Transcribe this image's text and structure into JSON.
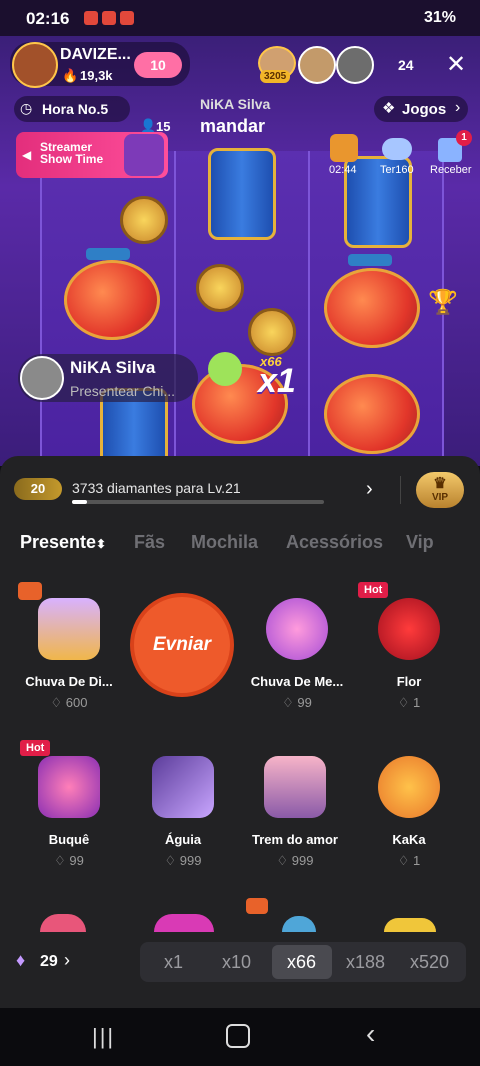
{
  "status_bar": {
    "time": "02:16",
    "battery": "31%"
  },
  "stream": {
    "host_name": "DAVIZE...",
    "host_followers": "19,3k",
    "host_level": "10",
    "top_viewer_count": "3205",
    "viewer_count": "24",
    "hour_label": "Hora No.5",
    "nika_label": "NiKA Silva",
    "mandar_label": "mandar",
    "count_15": "15",
    "jogos_label": "Jogos",
    "banner_title": "Streamer Show Time",
    "timer_text": "02:44",
    "ter_label": "Ter160",
    "receber_label": "Receber",
    "receber_badge": "1",
    "gift_sender_name": "NiKA Silva",
    "gift_sender_action": "Presentear Chi...",
    "multiplier_small": "x66",
    "multiplier_big": "x1"
  },
  "panel": {
    "diamond_level_badge": "20",
    "progress_text": "3733 diamantes para Lv.21",
    "progress_fraction": 0.06,
    "vip_label": "VIP",
    "tabs": [
      "Presente",
      "Fãs",
      "Mochila",
      "Acessórios",
      "Vip"
    ],
    "send_button": "Evniar",
    "gifts_row1": [
      {
        "name": "Chuva De Di...",
        "price": "600",
        "hot": false
      },
      {
        "name": "Chuva De Me...",
        "price": "99",
        "hot": false
      },
      {
        "name": "Flor",
        "price": "1",
        "hot": true
      }
    ],
    "gifts_row2": [
      {
        "name": "Buquê",
        "price": "99",
        "hot": true
      },
      {
        "name": "Águia",
        "price": "999",
        "hot": false
      },
      {
        "name": "Trem do amor",
        "price": "999",
        "hot": false
      },
      {
        "name": "KaKa",
        "price": "1",
        "hot": false
      }
    ],
    "hot_tag": "Hot",
    "balance": "29",
    "multipliers": [
      "x1",
      "x10",
      "x66",
      "x188",
      "x520"
    ]
  },
  "colors": {
    "accent_orange": "#ee5a2b",
    "hot_red": "#e11e48",
    "panel_bg": "#222224"
  }
}
